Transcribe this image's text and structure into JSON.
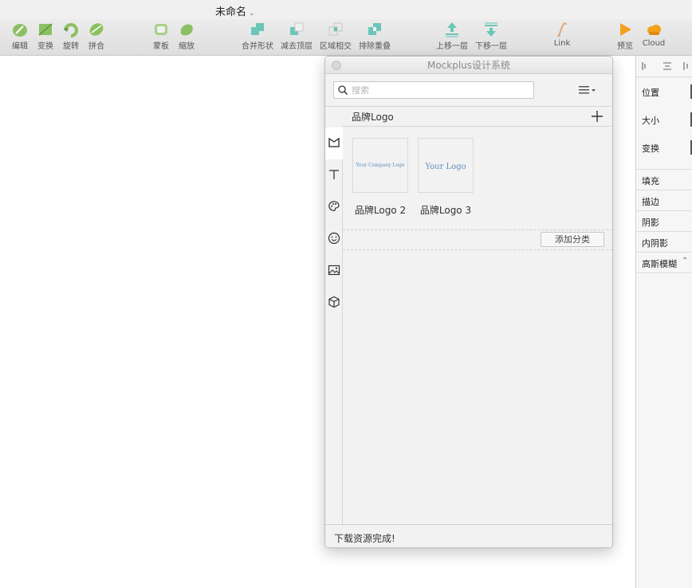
{
  "window": {
    "title": "未命名"
  },
  "toolbar": {
    "items": [
      {
        "id": "edit",
        "label": "编辑",
        "icon": "edit-icon"
      },
      {
        "id": "transform",
        "label": "变换",
        "icon": "transform-icon"
      },
      {
        "id": "rotate",
        "label": "旋转",
        "icon": "rotate-icon"
      },
      {
        "id": "combine",
        "label": "拼合",
        "icon": "combine-icon"
      },
      {
        "id": "mask",
        "label": "蒙板",
        "icon": "mask-icon"
      },
      {
        "id": "scale",
        "label": "缩放",
        "icon": "scale-icon"
      },
      {
        "id": "union",
        "label": "合并形状",
        "icon": "union-icon"
      },
      {
        "id": "subtract",
        "label": "减去顶层",
        "icon": "subtract-icon"
      },
      {
        "id": "intersect",
        "label": "区域相交",
        "icon": "intersect-icon"
      },
      {
        "id": "difference",
        "label": "排除重叠",
        "icon": "difference-icon"
      },
      {
        "id": "forward",
        "label": "上移一层",
        "icon": "bring-forward-icon"
      },
      {
        "id": "backward",
        "label": "下移一层",
        "icon": "send-backward-icon"
      },
      {
        "id": "link",
        "label": "Link",
        "icon": "link-icon"
      },
      {
        "id": "preview",
        "label": "预览",
        "icon": "play-icon"
      },
      {
        "id": "cloud",
        "label": "Cloud",
        "icon": "cloud-icon"
      }
    ]
  },
  "panel": {
    "title": "Mockplus设计系统",
    "search": {
      "placeholder": "搜索",
      "value": ""
    },
    "sidebar": [
      {
        "id": "logo",
        "icon": "brand-logo-icon",
        "active": true
      },
      {
        "id": "text",
        "icon": "text-style-icon",
        "active": false
      },
      {
        "id": "color",
        "icon": "palette-icon",
        "active": false
      },
      {
        "id": "icons",
        "icon": "smiley-icon",
        "active": false
      },
      {
        "id": "images",
        "icon": "image-icon",
        "active": false
      },
      {
        "id": "components",
        "icon": "cube-icon",
        "active": false
      }
    ],
    "category": {
      "title": "品牌Logo",
      "items": [
        {
          "caption": "品牌Logo 2",
          "logo_text": "Your Company Logo"
        },
        {
          "caption": "品牌Logo 3",
          "logo_text": "Your Logo"
        }
      ]
    },
    "add_category_label": "添加分类",
    "status": "下载资源完成!"
  },
  "inspector": {
    "tabs": [
      "align-left-icon",
      "align-center-icon",
      "distribute-icon"
    ],
    "props": [
      "位置",
      "大小",
      "变换"
    ],
    "styles": [
      "填充",
      "描边",
      "阴影",
      "内阴影",
      "高斯模糊"
    ]
  },
  "colors": {
    "accent_green": "#8cc063",
    "accent_teal": "#6bc5b8",
    "logo_blue": "#5b8fc2",
    "play_orange": "#f3a21b"
  }
}
